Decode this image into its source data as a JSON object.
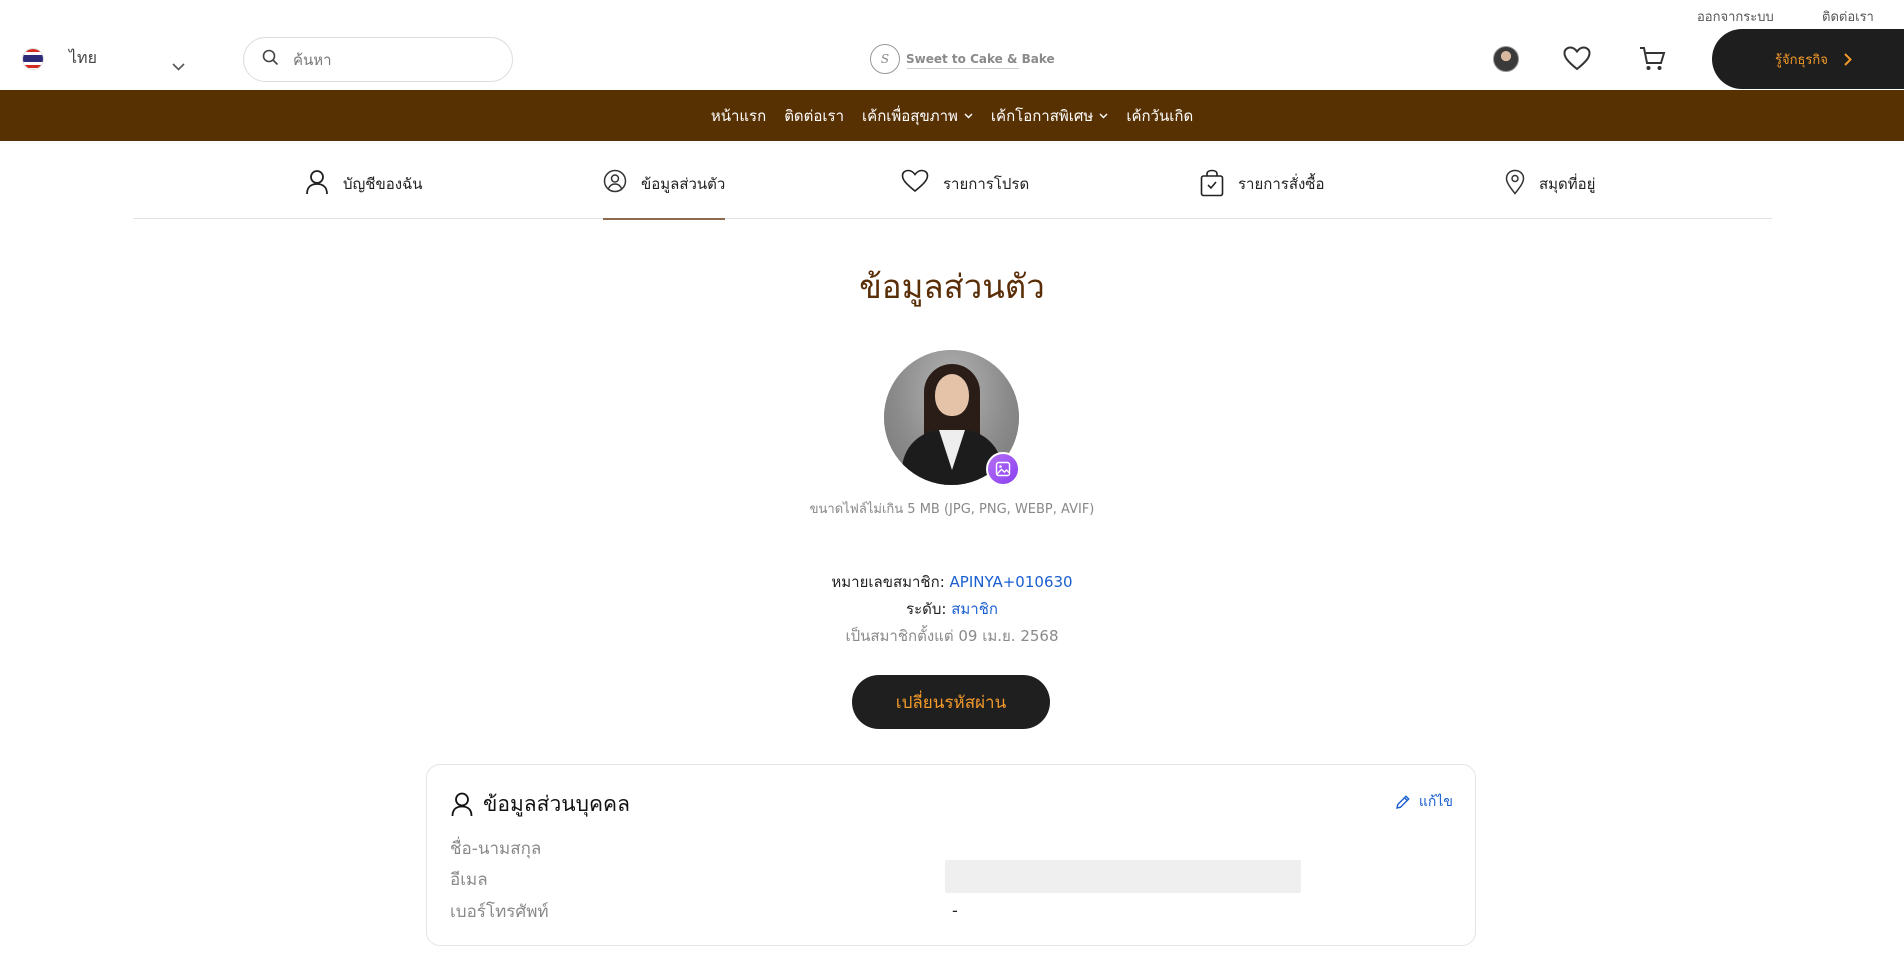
{
  "top_links": {
    "logout": "ออกจากระบบ",
    "contact": "ติดต่อเรา"
  },
  "header": {
    "language": "ไทย",
    "search_placeholder": "ค้นหา",
    "logo_text": "Sweet to Cake & Bake",
    "business_button": "รู้จักธุรกิจ"
  },
  "nav": {
    "items": [
      {
        "label": "หน้าแรก",
        "dropdown": false
      },
      {
        "label": "ติดต่อเรา",
        "dropdown": false
      },
      {
        "label": "เค้กเพื่อสุขภาพ",
        "dropdown": true
      },
      {
        "label": "เค้กโอกาสพิเศษ",
        "dropdown": true
      },
      {
        "label": "เค้กวันเกิด",
        "dropdown": false
      }
    ]
  },
  "tabs": [
    {
      "label": "บัญชีของฉัน",
      "icon": "user-icon",
      "active": false
    },
    {
      "label": "ข้อมูลส่วนตัว",
      "icon": "profile-circle-icon",
      "active": true
    },
    {
      "label": "รายการโปรด",
      "icon": "heart-icon",
      "active": false
    },
    {
      "label": "รายการสั่งซื้อ",
      "icon": "shopping-bag-icon",
      "active": false
    },
    {
      "label": "สมุดที่อยู่",
      "icon": "location-pin-icon",
      "active": false
    }
  ],
  "page": {
    "title": "ข้อมูลส่วนตัว",
    "file_hint": "ขนาดไฟล์ไม่เกิน 5 MB (JPG, PNG, WEBP, AVIF)"
  },
  "member": {
    "id_label": "หมายเลขสมาชิก:",
    "id_value": "APINYA+010630",
    "level_label": "ระดับ:",
    "level_value": "สมาชิก",
    "since": "เป็นสมาชิกตั้งแต่ 09 เม.ย. 2568",
    "change_password": "เปลี่ยนรหัสผ่าน"
  },
  "personal_card": {
    "title": "ข้อมูลส่วนบุคคล",
    "edit": "แก้ไข",
    "fields": [
      {
        "label": "ชื่อ-นามสกุล",
        "value": ""
      },
      {
        "label": "อีเมล",
        "value": ""
      },
      {
        "label": "เบอร์โทรศัพท์",
        "value": "-"
      }
    ]
  },
  "colors": {
    "nav_bg": "#583103",
    "accent_orange": "#f39a2a",
    "title_brown": "#5a2e07",
    "link_blue": "#1a5fd0",
    "dark_button": "#1f1f1f"
  }
}
